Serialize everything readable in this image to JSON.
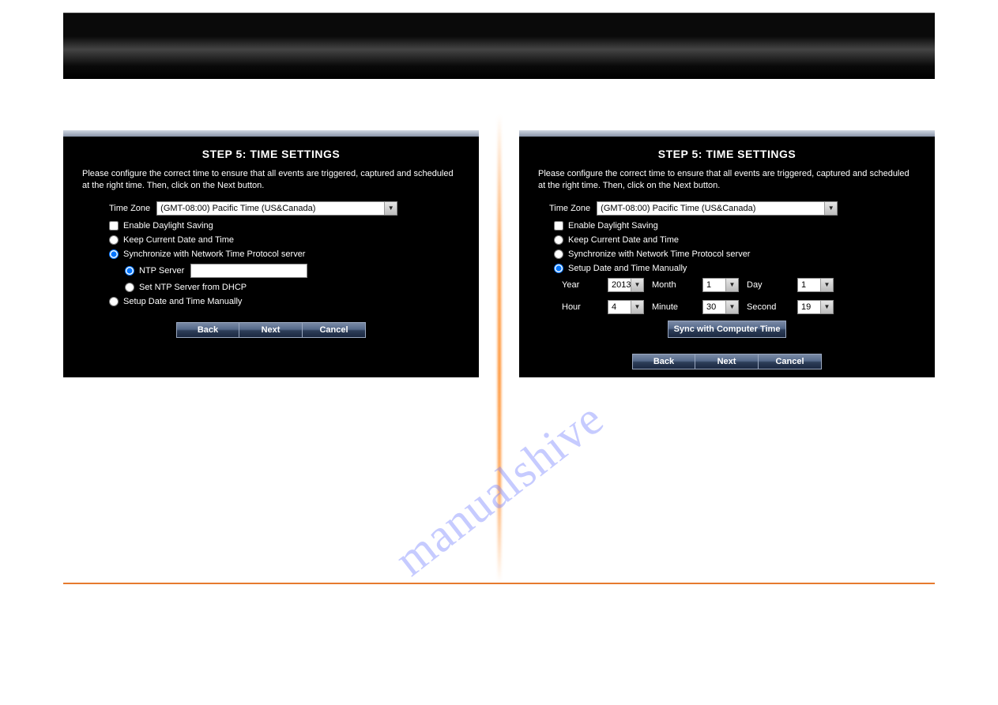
{
  "watermark": "manualshive",
  "panelLeft": {
    "title": "STEP 5: TIME SETTINGS",
    "desc": "Please configure the correct time to ensure that all events are triggered, captured and scheduled at the right time. Then, click on the Next button.",
    "timezoneLabel": "Time Zone",
    "timezoneValue": "(GMT-08:00) Pacific Time (US&Canada)",
    "daylight": "Enable Daylight Saving",
    "optKeep": "Keep Current Date and Time",
    "optSync": "Synchronize with Network Time Protocol server",
    "ntpLabel": "NTP Server",
    "ntpValue": "",
    "optDhcp": "Set NTP Server from DHCP",
    "optManual": "Setup Date and Time Manually",
    "btnBack": "Back",
    "btnNext": "Next",
    "btnCancel": "Cancel"
  },
  "panelRight": {
    "title": "STEP 5: TIME SETTINGS",
    "desc": "Please configure the correct time to ensure that all events are triggered, captured and scheduled at the right time. Then, click on the Next button.",
    "timezoneLabel": "Time Zone",
    "timezoneValue": "(GMT-08:00) Pacific Time (US&Canada)",
    "daylight": "Enable Daylight Saving",
    "optKeep": "Keep Current Date and Time",
    "optSync": "Synchronize with Network Time Protocol server",
    "optManual": "Setup Date and Time Manually",
    "yearLabel": "Year",
    "yearValue": "2013",
    "monthLabel": "Month",
    "monthValue": "1",
    "dayLabel": "Day",
    "dayValue": "1",
    "hourLabel": "Hour",
    "hourValue": "4",
    "minuteLabel": "Minute",
    "minuteValue": "30",
    "secondLabel": "Second",
    "secondValue": "19",
    "syncBtn": "Sync with Computer Time",
    "btnBack": "Back",
    "btnNext": "Next",
    "btnCancel": "Cancel"
  }
}
